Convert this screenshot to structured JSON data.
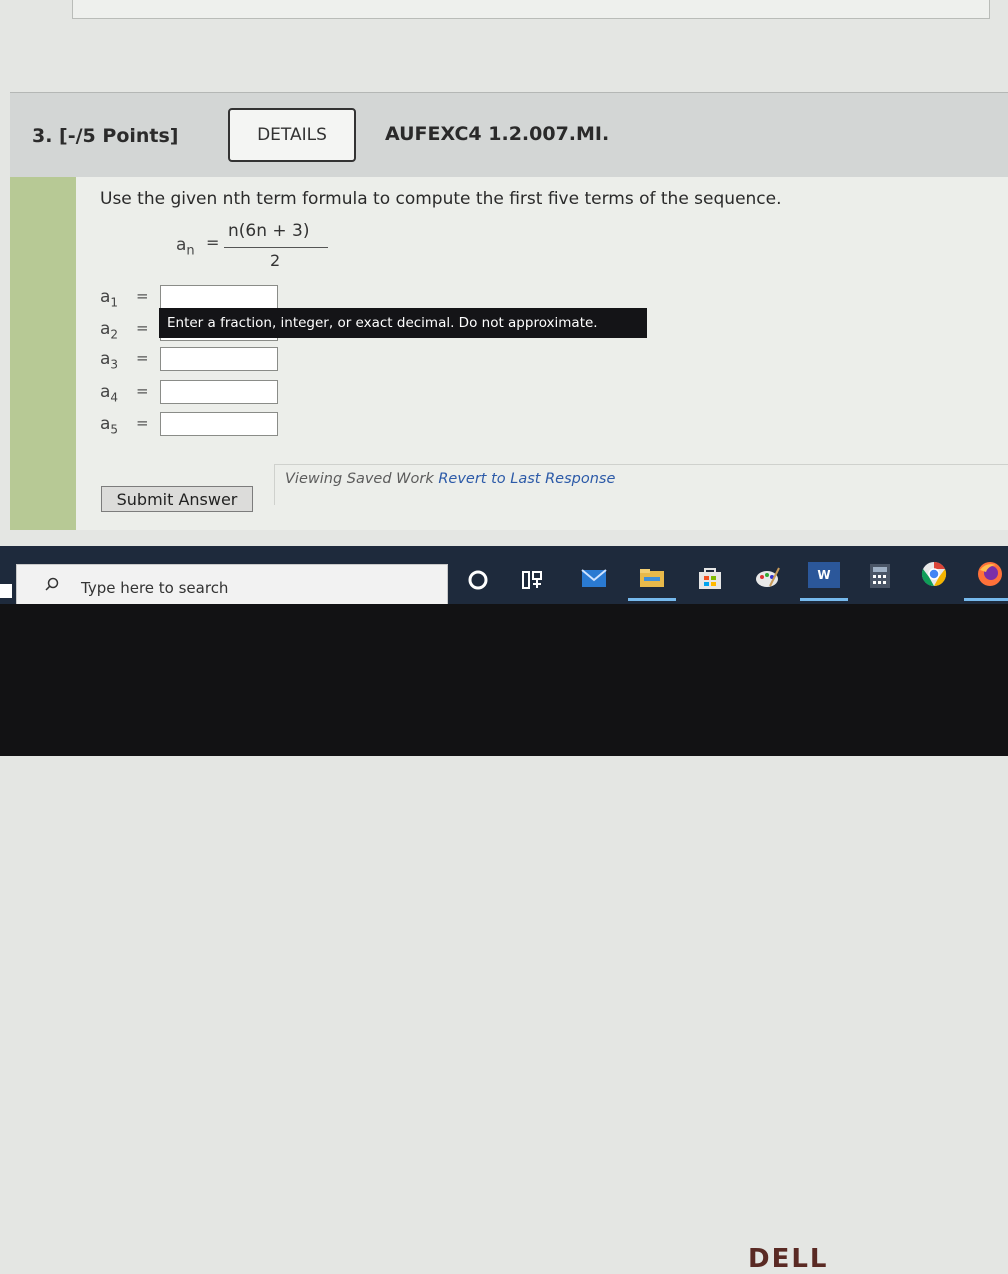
{
  "question": {
    "number_label": "3. [-/5 Points]",
    "details_label": "DETAILS",
    "code": "AUFEXC4 1.2.007.MI."
  },
  "prompt": {
    "text": "Use the given nth term formula to compute the first five terms of the sequence.",
    "formula": {
      "lhs": "a",
      "lhs_sub": "n",
      "equals": "=",
      "numerator": "n(6n + 3)",
      "denominator": "2"
    }
  },
  "answers": [
    {
      "label": "a",
      "sub": "1",
      "equals": "=",
      "value": ""
    },
    {
      "label": "a",
      "sub": "2",
      "equals": "=",
      "value": ""
    },
    {
      "label": "a",
      "sub": "3",
      "equals": "=",
      "value": ""
    },
    {
      "label": "a",
      "sub": "4",
      "equals": "=",
      "value": ""
    },
    {
      "label": "a",
      "sub": "5",
      "equals": "=",
      "value": ""
    }
  ],
  "tooltip": "Enter a fraction, integer, or exact decimal. Do not approximate.",
  "submit_label": "Submit Answer",
  "status": {
    "text": "Viewing Saved Work",
    "link": "Revert to Last Response"
  },
  "taskbar": {
    "search_placeholder": "Type here to search",
    "icons": [
      "start-icon",
      "cortana-icon",
      "task-view-icon",
      "mail-icon",
      "file-explorer-icon",
      "store-icon",
      "paint-icon",
      "word-icon",
      "calculator-icon",
      "chrome-icon",
      "firefox-icon"
    ],
    "word_badge": "W"
  },
  "colors": {
    "sidebar_green": "#b7c995",
    "link_blue": "#2c5aa8",
    "taskbar_bg": "#1e2a3c"
  },
  "bezel_logo": "DELL"
}
